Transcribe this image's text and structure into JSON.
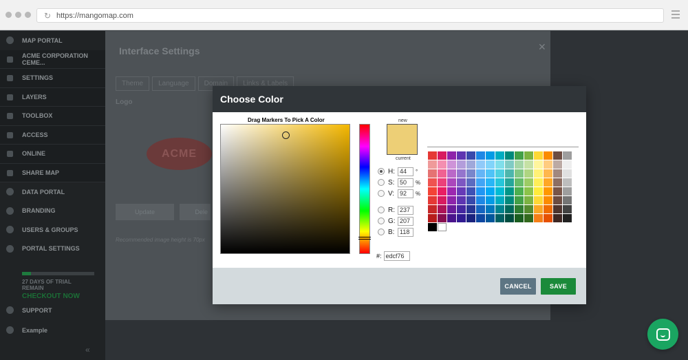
{
  "browser": {
    "url": "https://mangomap.com"
  },
  "sidebar": {
    "items": [
      {
        "label": "MAP PORTAL",
        "sub": false
      },
      {
        "label": "ACME Corporation Ceme...",
        "sub": true
      },
      {
        "label": "SETTINGS",
        "sub": true
      },
      {
        "label": "LAYERS",
        "sub": true
      },
      {
        "label": "TOOLBOX",
        "sub": true
      },
      {
        "label": "ACCESS",
        "sub": true
      },
      {
        "label": "ONLINE",
        "sub": true
      },
      {
        "label": "SHARE MAP",
        "sub": true
      },
      {
        "label": "DATA PORTAL",
        "sub": false
      },
      {
        "label": "BRANDING",
        "sub": false
      },
      {
        "label": "USERS & GROUPS",
        "sub": false
      },
      {
        "label": "PORTAL SETTINGS",
        "sub": false
      }
    ],
    "trial_text": "27 DAYS OF TRIAL REMAIN",
    "trial_progress": 0.12,
    "checkout_label": "CHECKOUT NOW",
    "support_label": "SUPPORT",
    "user_label": "Example"
  },
  "panel": {
    "title": "Interface Settings",
    "tabs": [
      "Theme",
      "Language",
      "Domain",
      "Links & Labels"
    ],
    "logo_label": "Logo",
    "logo_text": "ACME",
    "update_label": "Update",
    "delete_label": "Dele",
    "hint": "Recommended image height is 70px"
  },
  "modal": {
    "title": "Choose Color",
    "drag_label": "Drag Markers To Pick A Color",
    "new_label": "new",
    "current_label": "current",
    "color_hex": "#edcf76",
    "fields": {
      "h": {
        "label": "H:",
        "value": "44",
        "unit": "°"
      },
      "s": {
        "label": "S:",
        "value": "50",
        "unit": "%"
      },
      "v": {
        "label": "V:",
        "value": "92",
        "unit": "%"
      },
      "r": {
        "label": "R:",
        "value": "237",
        "unit": ""
      },
      "g": {
        "label": "G:",
        "value": "207",
        "unit": ""
      },
      "b": {
        "label": "B:",
        "value": "118",
        "unit": ""
      }
    },
    "hex_label": "#:",
    "hex_value": "edcf76",
    "cancel_label": "CANCEL",
    "save_label": "SAVE"
  },
  "palette": [
    [
      "#e53935",
      "#d81b60",
      "#8e24aa",
      "#5e35b1",
      "#3949ab",
      "#1e88e5",
      "#039be5",
      "#00acc1",
      "#00897b",
      "#43a047",
      "#7cb342",
      "#fdd835",
      "#fb8c00",
      "#6d4c41",
      "#9e9e9e"
    ],
    [
      "#ef9a9a",
      "#f48fb1",
      "#ce93d8",
      "#b39ddb",
      "#9fa8da",
      "#90caf9",
      "#81d4fa",
      "#80deea",
      "#80cbc4",
      "#a5d6a7",
      "#c5e1a5",
      "#fff59d",
      "#ffcc80",
      "#bcaaa4",
      "#eeeeee"
    ],
    [
      "#e57373",
      "#f06292",
      "#ba68c8",
      "#9575cd",
      "#7986cb",
      "#64b5f6",
      "#4fc3f7",
      "#4dd0e1",
      "#4db6ac",
      "#81c784",
      "#aed581",
      "#fff176",
      "#ffb74d",
      "#a1887f",
      "#e0e0e0"
    ],
    [
      "#ef5350",
      "#ec407a",
      "#ab47bc",
      "#7e57c2",
      "#5c6bc0",
      "#42a5f5",
      "#29b6f6",
      "#26c6da",
      "#26a69a",
      "#66bb6a",
      "#9ccc65",
      "#ffee58",
      "#ffa726",
      "#8d6e63",
      "#bdbdbd"
    ],
    [
      "#f44336",
      "#e91e63",
      "#9c27b0",
      "#673ab7",
      "#3f51b5",
      "#2196f3",
      "#03a9f4",
      "#00bcd4",
      "#009688",
      "#4caf50",
      "#8bc34a",
      "#ffeb3b",
      "#ff9800",
      "#795548",
      "#9e9e9e"
    ],
    [
      "#e53935",
      "#d81b60",
      "#8e24aa",
      "#5e35b1",
      "#3949ab",
      "#1e88e5",
      "#039be5",
      "#00acc1",
      "#00897b",
      "#43a047",
      "#7cb342",
      "#fdd835",
      "#fb8c00",
      "#6d4c41",
      "#757575"
    ],
    [
      "#c62828",
      "#ad1457",
      "#6a1b9a",
      "#4527a0",
      "#283593",
      "#1565c0",
      "#0277bd",
      "#00838f",
      "#00695c",
      "#2e7d32",
      "#558b2f",
      "#f9a825",
      "#ef6c00",
      "#4e342e",
      "#424242"
    ],
    [
      "#b71c1c",
      "#880e4f",
      "#4a148c",
      "#311b92",
      "#1a237e",
      "#0d47a1",
      "#01579b",
      "#006064",
      "#004d40",
      "#1b5e20",
      "#33691e",
      "#f57f17",
      "#e65100",
      "#3e2723",
      "#212121"
    ],
    [
      "#000000",
      "#ffffff"
    ]
  ]
}
